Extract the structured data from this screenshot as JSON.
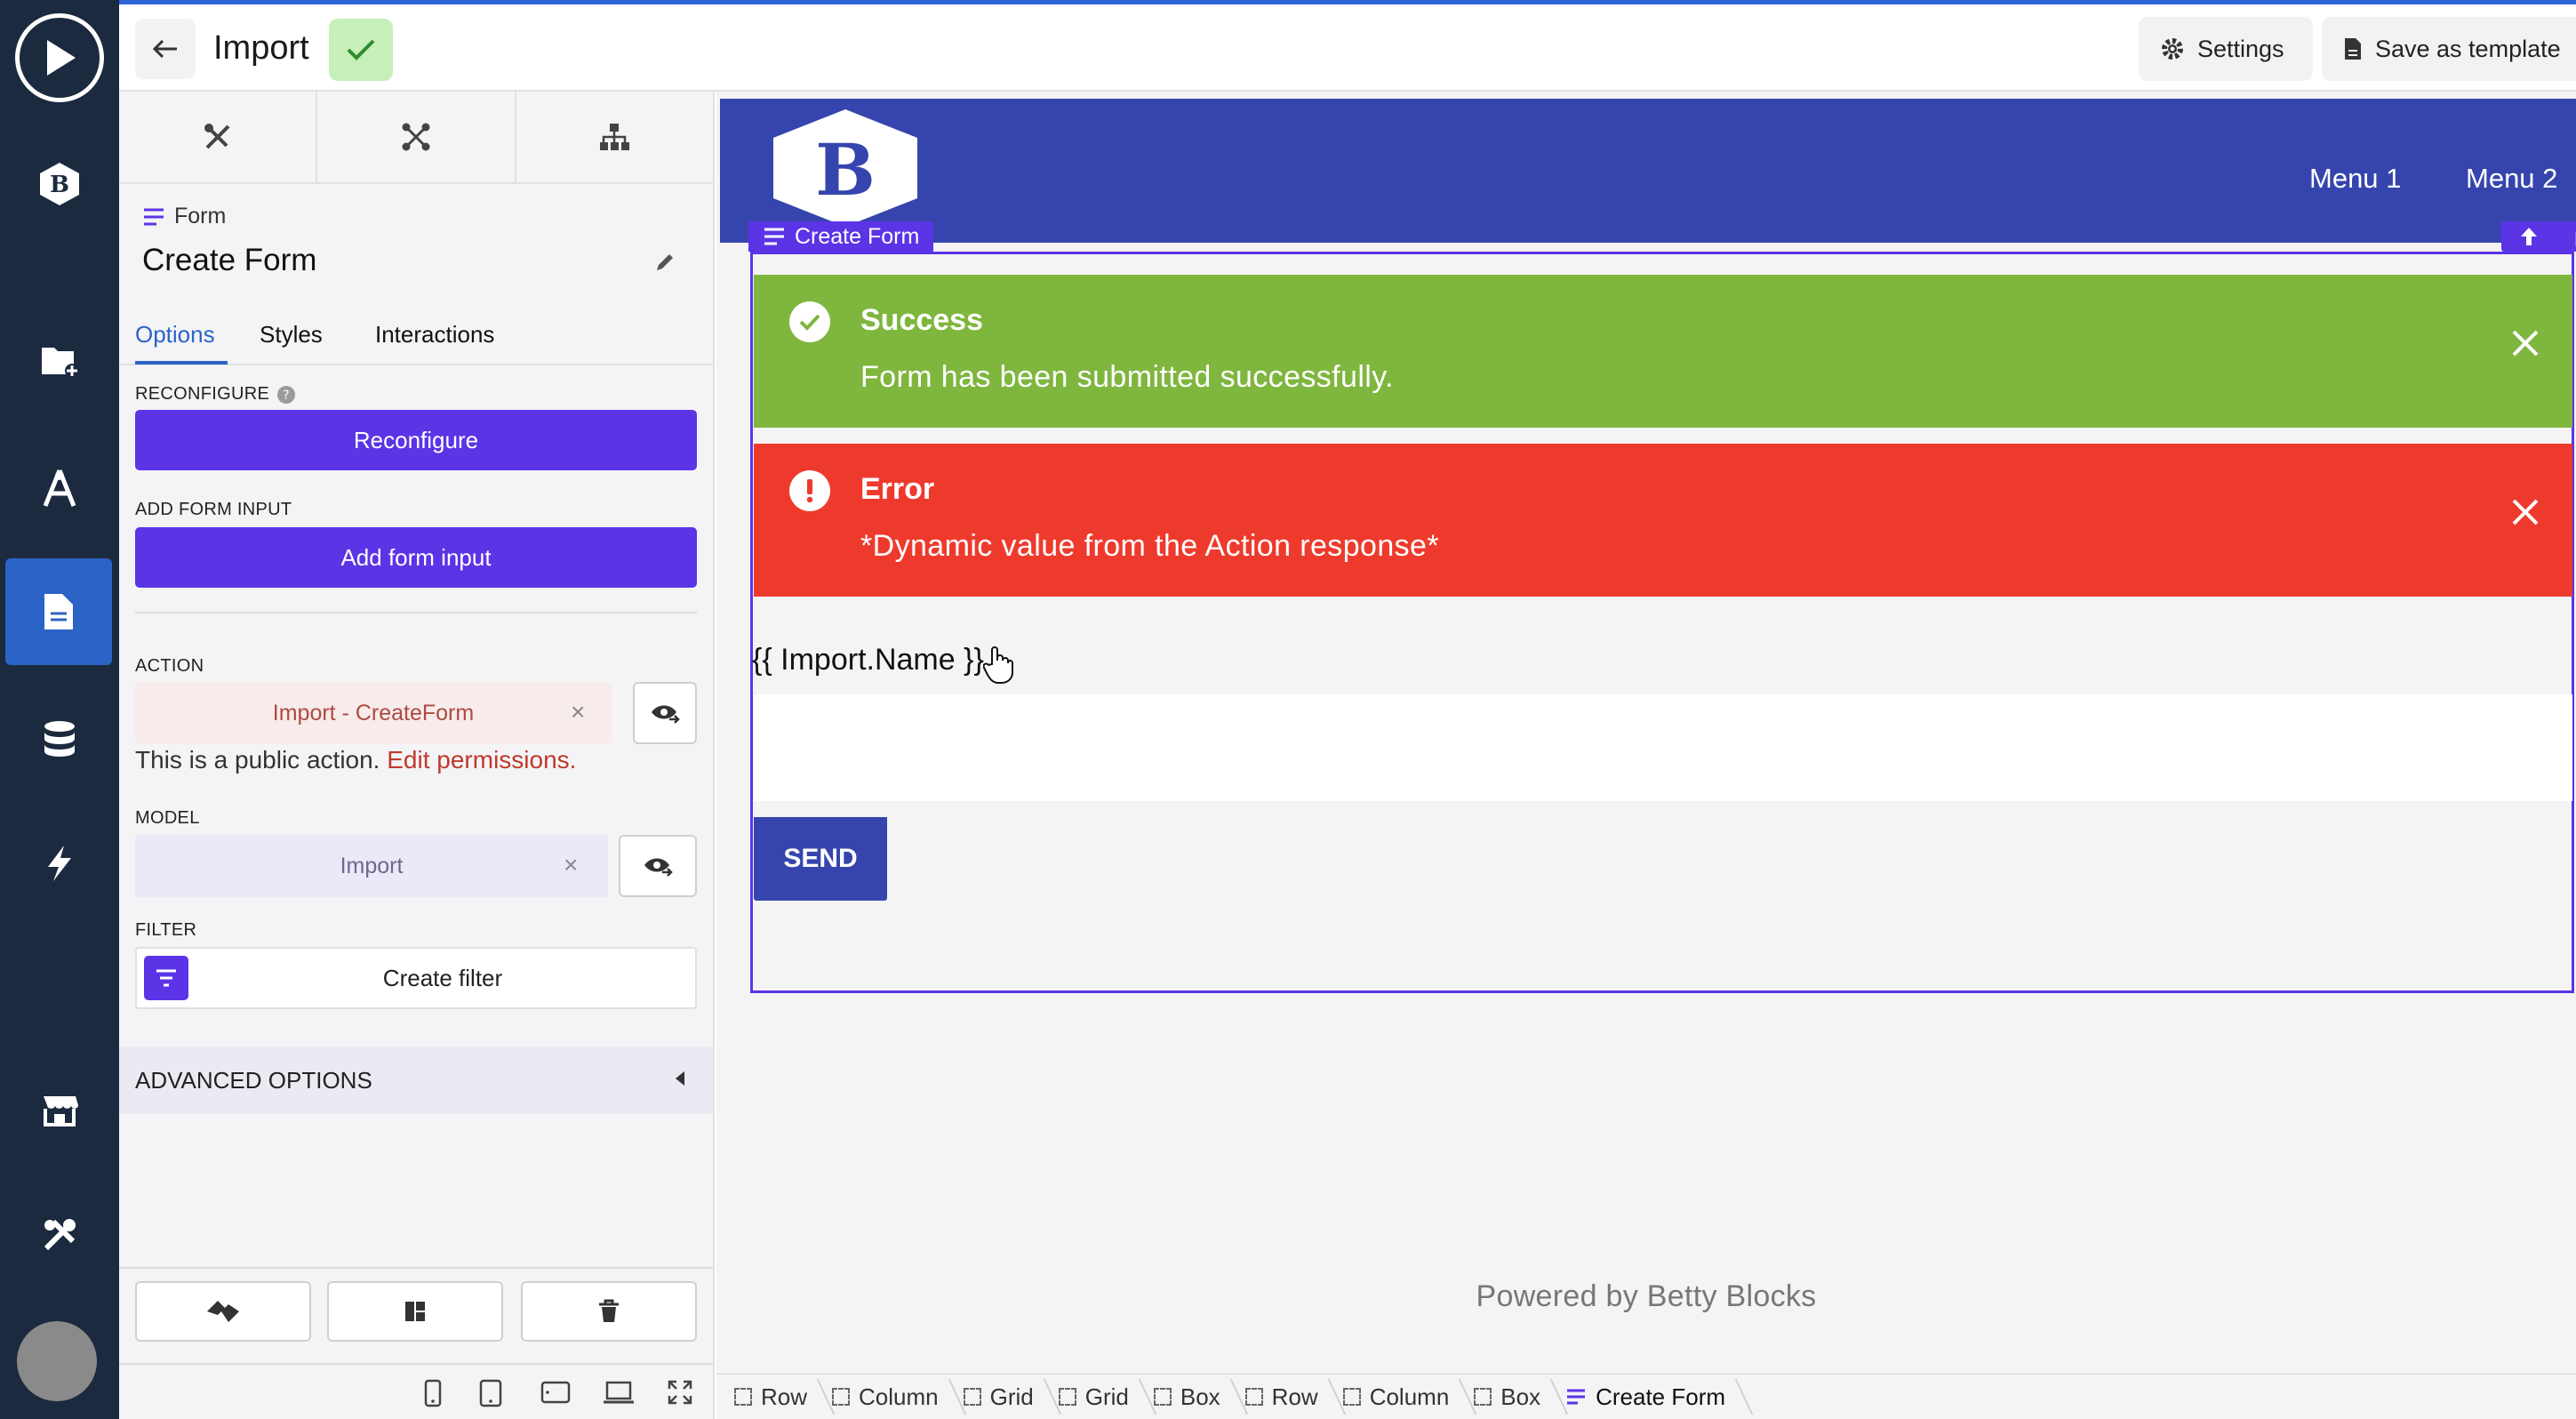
{
  "topbar": {
    "title": "Import",
    "settings_label": "Settings",
    "template_label": "Save as template"
  },
  "panel": {
    "component_type": "Form",
    "component_name": "Create Form",
    "subtabs": [
      "Options",
      "Styles",
      "Interactions"
    ],
    "reconfigure": {
      "label": "RECONFIGURE",
      "button": "Reconfigure"
    },
    "add_input": {
      "label": "ADD FORM INPUT",
      "button": "Add form input"
    },
    "action": {
      "label": "ACTION",
      "value": "Import - CreateForm",
      "public_text": "This is a public action.",
      "permissions_link": "Edit permissions."
    },
    "model": {
      "label": "MODEL",
      "value": "Import"
    },
    "filter": {
      "label": "FILTER",
      "button": "Create filter"
    },
    "advanced": "ADVANCED OPTIONS"
  },
  "canvas": {
    "menu": [
      "Menu 1",
      "Menu 2"
    ],
    "logo_letter": "B",
    "form_tag": "Create Form",
    "success": {
      "title": "Success",
      "message": "Form has been submitted successfully."
    },
    "error": {
      "title": "Error",
      "message": "*Dynamic value from the Action response*"
    },
    "field_label": "{{ Import.Name }}",
    "send_label": "SEND",
    "powered_by": "Powered by Betty Blocks"
  },
  "breadcrumb": [
    "Row",
    "Column",
    "Grid",
    "Grid",
    "Box",
    "Row",
    "Column",
    "Box",
    "Create Form"
  ],
  "colors": {
    "rail": "#1c2a3f",
    "accent_blue": "#2c63c7",
    "purple": "#5b34e6",
    "header_blue": "#3545ad",
    "success_green": "#7fb63e",
    "error_red": "#ee3a2d"
  }
}
